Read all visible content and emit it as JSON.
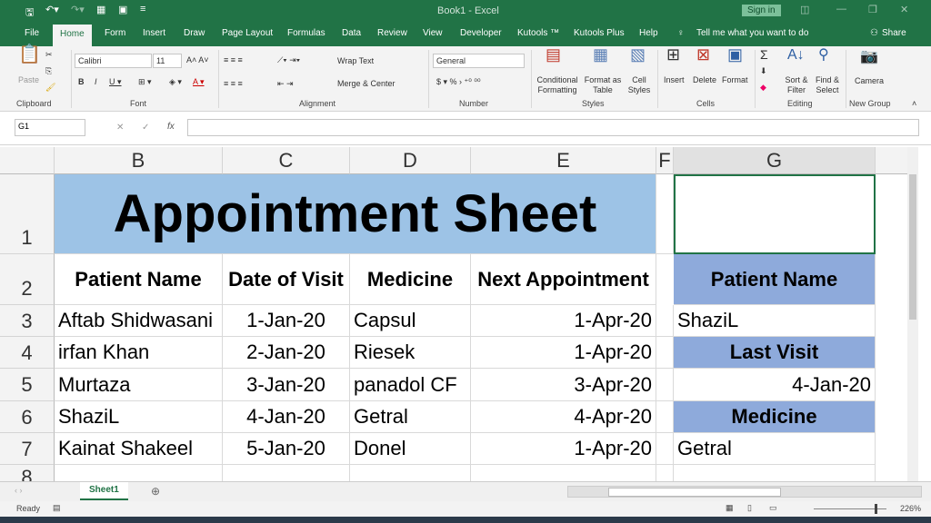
{
  "titlebar": {
    "title": "Book1 - Excel",
    "sign_in": "Sign in"
  },
  "tabs": [
    "File",
    "Home",
    "Form",
    "Insert",
    "Draw",
    "Page Layout",
    "Formulas",
    "Data",
    "Review",
    "View",
    "Developer",
    "Kutools ™",
    "Kutools Plus",
    "Help"
  ],
  "tell_me": "Tell me what you want to do",
  "share": "Share",
  "ribbon": {
    "paste": "Paste",
    "font_name": "Calibri",
    "font_size": "11",
    "wrap_text": "Wrap Text",
    "merge_center": "Merge & Center",
    "number_format": "General",
    "conditional": "Conditional Formatting",
    "format_table": "Format as Table",
    "cell_styles": "Cell Styles",
    "insert": "Insert",
    "delete": "Delete",
    "format": "Format",
    "sort_filter": "Sort & Filter",
    "find_select": "Find & Select",
    "camera": "Camera",
    "groups": [
      "Clipboard",
      "Font",
      "Alignment",
      "Number",
      "Styles",
      "Cells",
      "Editing",
      "New Group"
    ]
  },
  "formula_bar": {
    "name_box": "G1",
    "fx": "fx",
    "value": ""
  },
  "columns": [
    "B",
    "C",
    "D",
    "E",
    "F",
    "G"
  ],
  "rows": [
    "1",
    "2",
    "3",
    "4",
    "5",
    "6",
    "7",
    "8"
  ],
  "sheet": {
    "title": "Appointment Sheet",
    "headers": [
      "Patient Name",
      "Date of Visit",
      "Medicine",
      "Next Appointment"
    ],
    "data": [
      [
        "Aftab Shidwasani",
        "1-Jan-20",
        "Capsul",
        "1-Apr-20"
      ],
      [
        "irfan Khan",
        "2-Jan-20",
        "Riesek",
        "1-Apr-20"
      ],
      [
        "Murtaza",
        "3-Jan-20",
        "panadol CF",
        "3-Apr-20"
      ],
      [
        "ShaziL",
        "4-Jan-20",
        "Getral",
        "4-Apr-20"
      ],
      [
        "Kainat Shakeel",
        "5-Jan-20",
        "Donel",
        "1-Apr-20"
      ]
    ],
    "lookup": {
      "patient_label": "Patient Name",
      "patient": "ShaziL",
      "last_visit_label": "Last Visit",
      "last_visit": "4-Jan-20",
      "medicine_label": "Medicine",
      "medicine": "Getral"
    }
  },
  "sheet_tab": "Sheet1",
  "status": {
    "ready": "Ready",
    "zoom": "226%"
  },
  "colors": {
    "excel_green": "#217346",
    "title_fill": "#9dc3e6",
    "lookup_fill": "#8eaadb"
  }
}
